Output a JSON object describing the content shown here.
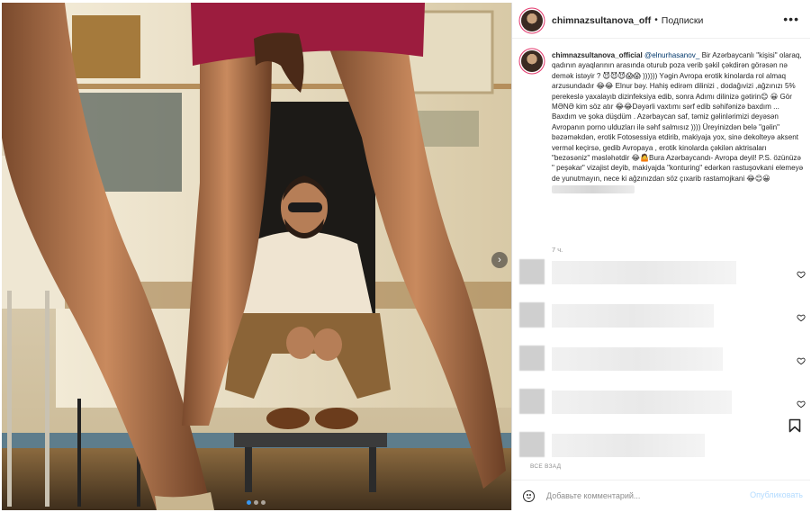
{
  "post": {
    "username": "chimnazsultanova_off",
    "separator": "•",
    "follow_label": "Подписки",
    "more_icon": "more-horizontal-icon"
  },
  "caption": {
    "username": "chimnazsultanova_official",
    "mention": "@elnurhasanov_",
    "text": " Bir Azərbaycanlı \"kişisi\" olaraq, qadının ayaqlarının arasında oturub poza verib şəkil çəkdirən görəsən nə demək istəyir ? 😈😈😈😱😱 ))))))  Yəgin Avropa erotik kinolarda rol almaq arzusundadır 😂😂 Elnur bəy. Hahiş edirəm dilinizi , dodağıvizi ,ağzınızı 5% perekeslə yaxalayıb dizinfeksiya edib, sonra Adımı dilinizə gətirin😊 😀 Gör MƏNƏ kim söz atır 😂😂Dəyərli vaxtımı sərf edib səhifənizə baxdım ... Baxdım ve şoka düşdüm . Azərbaycan saf, təmiz gəlinlərimizi deyəsən Avropanın porno ulduzları ilə səhf salmısız )))) Üreyinizdən belə \"gəlin\" bəzəməkdən, erotik Fotosessiya etdirib, makiyaja yox, sinə dekolteyə aksent verməl keçirsə, gedib Avropaya , erotik kinolarda çəkilən aktrisaları \"bezəsəniz\" məsləhətdir 😂🤷Bura Azərbaycandı- Avropa deyil! P.S. özünüzə \" peşəkar\" vizajist deyib, makiyajda \"konturing\" edərkən rastuşovkani elemeyə de yunutmayın, nece ki ağzınızdan söz çıxarib rastamojkani 😂😊😀"
  },
  "time_ago": "7 ч.",
  "hidden_replies_label": "ВСЕ ВЗАД",
  "comment_bar": {
    "placeholder": "Добавьте комментарий...",
    "publish_label": "Опубликовать"
  },
  "icons": {
    "emoji": "emoji-icon",
    "heart": "heart-icon",
    "bookmark": "bookmark-icon",
    "carousel_next": "chevron-right-icon"
  },
  "carousel": {
    "slides": 3,
    "active": 1
  }
}
